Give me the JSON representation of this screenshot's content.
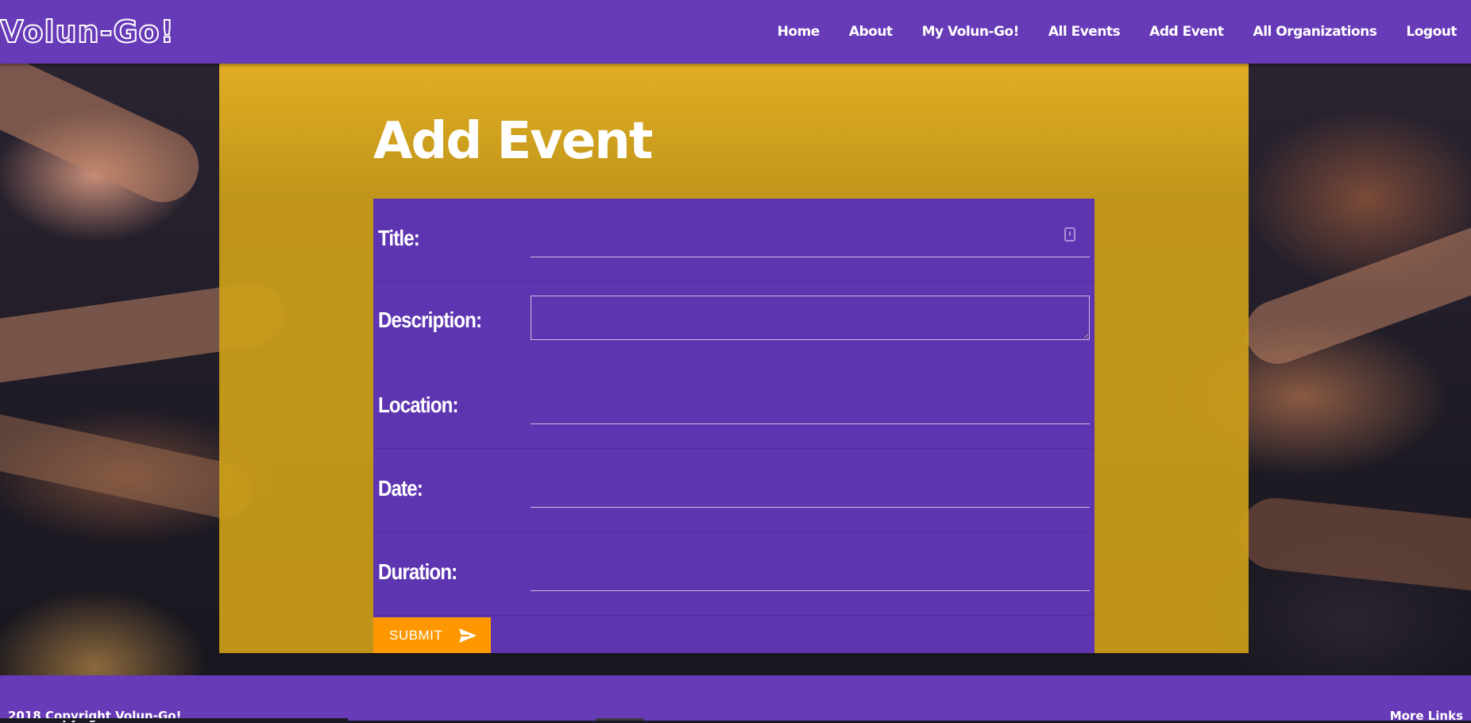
{
  "nav": {
    "brand": "Volun-Go!",
    "links": [
      "Home",
      "About",
      "My Volun-Go!",
      "All Events",
      "Add Event",
      "All Organizations",
      "Logout"
    ]
  },
  "page": {
    "title": "Add Event"
  },
  "form": {
    "fields": [
      {
        "label": "Title:",
        "value": ""
      },
      {
        "label": "Description:",
        "value": ""
      },
      {
        "label": "Location:",
        "value": ""
      },
      {
        "label": "Date:",
        "value": ""
      },
      {
        "label": "Duration:",
        "value": ""
      }
    ],
    "submit_label": "SUBMIT"
  },
  "footer": {
    "copyright": "2018 Copyright Volun-Go!",
    "right_text": "More Links"
  },
  "colors": {
    "primary": "#673ab7",
    "card": "#5e35b1",
    "overlay": "#cda019",
    "accent": "#ff9800"
  },
  "icons": {
    "submit": "send-icon",
    "title_field": "password-manager-key-icon"
  }
}
